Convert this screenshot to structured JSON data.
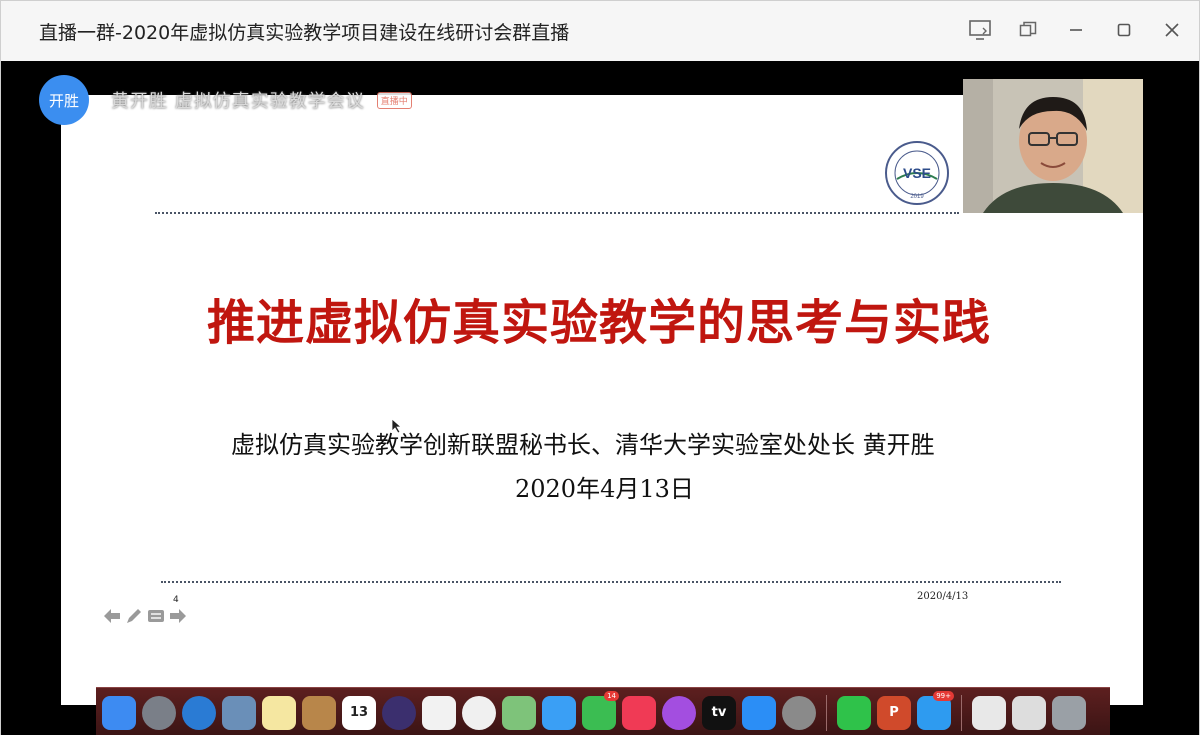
{
  "window": {
    "title": "直播一群-2020年虚拟仿真实验教学项目建设在线研讨会群直播"
  },
  "window_controls": [
    "share-screen-icon",
    "popout-icon",
    "minimize-icon",
    "maximize-icon",
    "close-icon"
  ],
  "speaker": {
    "avatar_text": "开胜",
    "name_line": "黄开胜  虚拟仿真实验教学会议",
    "live_tag": "直播中"
  },
  "slide": {
    "title": "推进虚拟仿真实验教学的思考与实践",
    "subtitle": "虚拟仿真实验教学创新联盟秘书长、清华大学实验室处处长  黄开胜",
    "date": "2020年4月13日",
    "footer_date": "2020/4/13",
    "page_number": "4",
    "logo_text": "VSE",
    "logo_year": "2019"
  },
  "dock": {
    "items": [
      {
        "name": "finder-icon",
        "color": "#3d8bf2"
      },
      {
        "name": "launchpad-icon",
        "color": "#7a7f88"
      },
      {
        "name": "safari-icon",
        "color": "#2a7bd4"
      },
      {
        "name": "mail-icon",
        "color": "#6a8fb8"
      },
      {
        "name": "notes-icon",
        "color": "#f5e7a1"
      },
      {
        "name": "contacts-icon",
        "color": "#b8864a"
      },
      {
        "name": "calendar-icon",
        "color": "#ffffff",
        "text": "13"
      },
      {
        "name": "siri-icon",
        "color": "#3b2f6e"
      },
      {
        "name": "reminders-icon",
        "color": "#f2f2f2"
      },
      {
        "name": "photos-icon",
        "color": "#f0f0f0"
      },
      {
        "name": "maps-icon",
        "color": "#7ec37a"
      },
      {
        "name": "messages-icon",
        "color": "#3a9ff5"
      },
      {
        "name": "facetime-icon",
        "color": "#3bbd52",
        "badge": "14"
      },
      {
        "name": "music-icon",
        "color": "#f03a55"
      },
      {
        "name": "podcasts-icon",
        "color": "#a34ee0"
      },
      {
        "name": "appletv-icon",
        "color": "#111111",
        "text": "tv"
      },
      {
        "name": "appstore-icon",
        "color": "#2b8ef6"
      },
      {
        "name": "system-preferences-icon",
        "color": "#8a8a8a"
      },
      {
        "name": "wechat-icon",
        "color": "#2fc24a"
      },
      {
        "name": "powerpoint-icon",
        "color": "#d04a2b",
        "text": "P"
      },
      {
        "name": "dingtalk-icon",
        "color": "#2e9bf0",
        "badge": "99+"
      },
      {
        "name": "document-icon",
        "color": "#e8e8e8"
      },
      {
        "name": "screen-icon",
        "color": "#dddddd"
      },
      {
        "name": "trash-icon",
        "color": "#9aa0a6"
      }
    ]
  }
}
